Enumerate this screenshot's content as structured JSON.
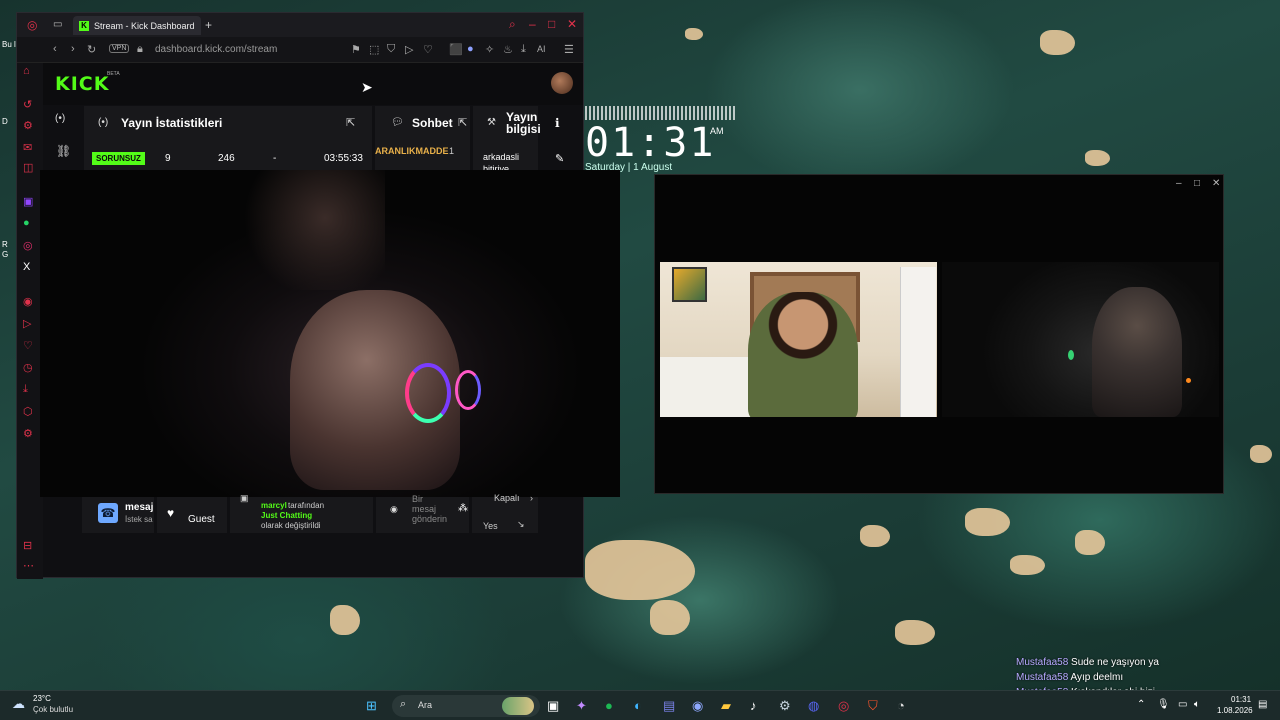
{
  "browser": {
    "tab_title": "Stream - Kick Dashboard",
    "tab_favicon": "K",
    "url": "dashboard.kick.com/stream",
    "vpn_label": "VPN",
    "ai_label": "AI",
    "new_tab": "+"
  },
  "kick": {
    "logo": "KICK",
    "beta": "BETA",
    "stats_panel": {
      "title": "Yayın İstatistikleri",
      "status_badge": "SORUNSUZ",
      "followers": "9",
      "viewers": "246",
      "dash": "-",
      "duration": "03:55:33"
    },
    "chat_panel": {
      "title": "Sohbet",
      "line_user": "ARANLIKMADDE",
      "line_count": "1"
    },
    "info_panel": {
      "title": "Yayın bilgisi",
      "title_line1": "Yayın",
      "title_line2": "bilgisi",
      "value": "arkadasli",
      "value2": "bitiriye"
    },
    "bottom": {
      "messages_label": "mesaj",
      "messages_sub": "İstek sa",
      "guest_label": "Guest",
      "activity_user": "marcyl",
      "activity_text": "tarafından",
      "activity_category": "Just Chatting",
      "activity_tail": "olarak değiştirildi",
      "send_placeholder_1": "Bir",
      "send_placeholder_2": "mesaj",
      "send_placeholder_3": "gönderin",
      "closed_label": "Kapalı",
      "yes_label": "Yes"
    }
  },
  "clock": {
    "time": "01:31",
    "ampm": "AM",
    "date": "Saturday | 1 August"
  },
  "left_strip": {
    "label_top": "Bu l",
    "label_a": "D",
    "label_b": "R",
    "label_c": "G"
  },
  "chat_overlay": [
    {
      "user": "Mustafaa58",
      "message": "Sude ne yaşıyon ya"
    },
    {
      "user": "Mustafaa58",
      "message": "Ayıp deelmı"
    },
    {
      "user": "Mustafaa58",
      "message": "Kıskandılar abi bizi"
    }
  ],
  "taskbar": {
    "weather_temp": "23°C",
    "weather_desc": "Çok bulutlu",
    "search_label": "Ara",
    "time": "01:31",
    "date": "1.08.2026"
  },
  "colors": {
    "kick_green": "#53fc18",
    "opera_red": "#e0324b",
    "chat_user": "#b7a8ff"
  }
}
